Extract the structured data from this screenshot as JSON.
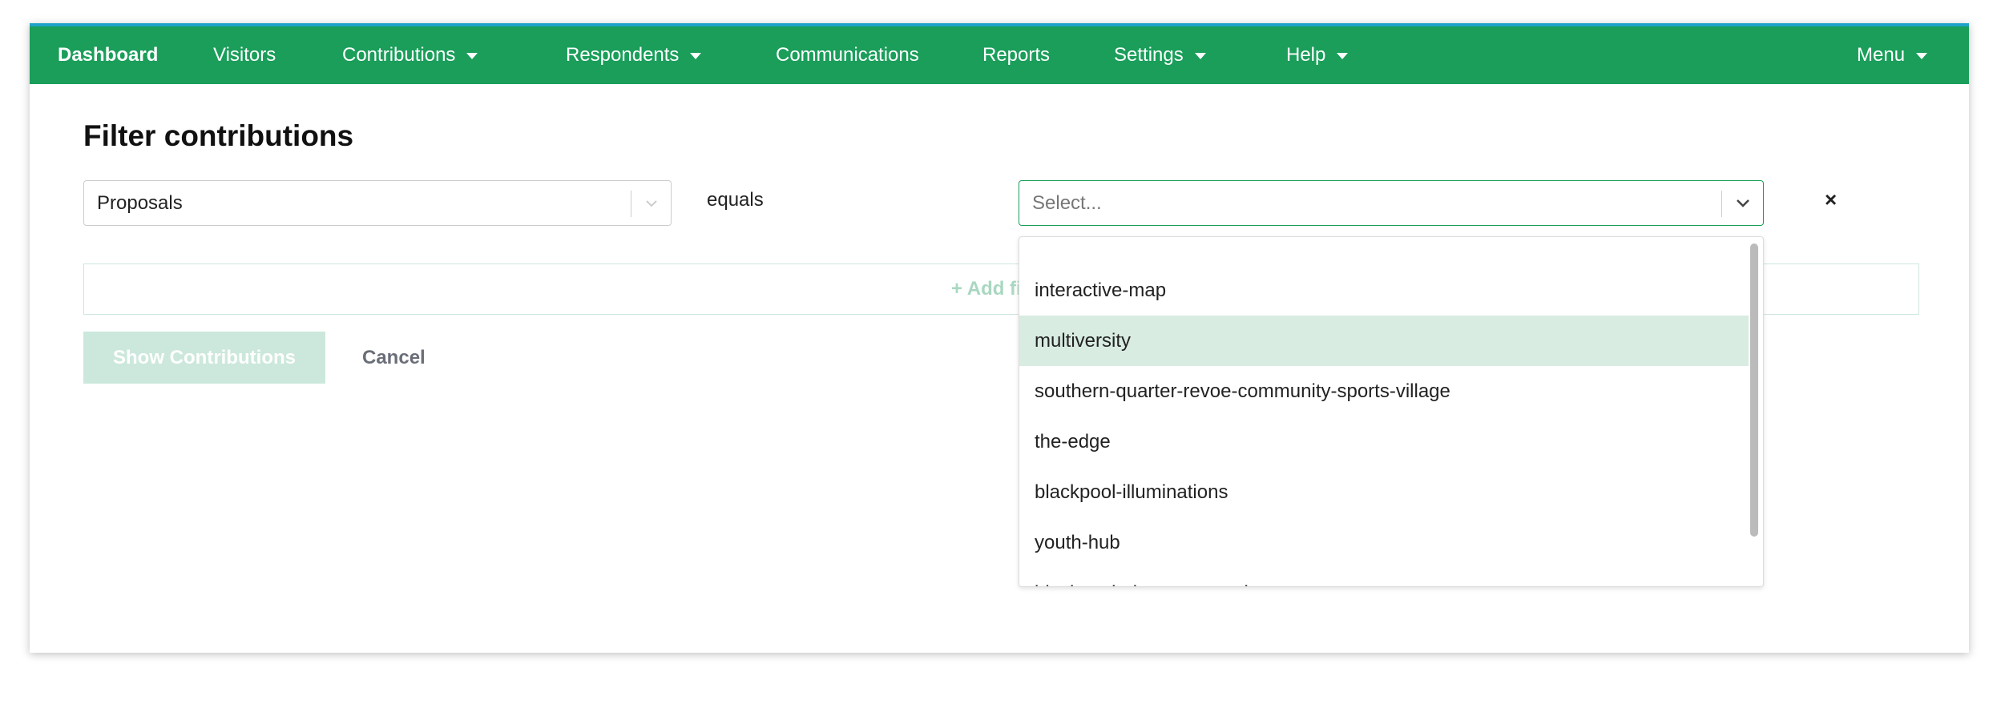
{
  "nav": {
    "items": [
      {
        "label": "Dashboard",
        "dropdown": false,
        "active": true
      },
      {
        "label": "Visitors",
        "dropdown": false
      },
      {
        "label": "Contributions",
        "dropdown": true
      },
      {
        "label": "Respondents",
        "dropdown": true
      },
      {
        "label": "Communications",
        "dropdown": false
      },
      {
        "label": "Reports",
        "dropdown": false
      },
      {
        "label": "Settings",
        "dropdown": true
      },
      {
        "label": "Help",
        "dropdown": true
      },
      {
        "label": "Menu",
        "dropdown": true
      }
    ],
    "color": "#1a9e5a"
  },
  "page": {
    "title": "Filter contributions"
  },
  "filter": {
    "field_value": "Proposals",
    "operator": "equals",
    "value_placeholder": "Select...",
    "remove_label": "×",
    "add_filter_label": "+ Add filter"
  },
  "dropdown": {
    "options": [
      "interactive-map",
      "multiversity",
      "southern-quarter-revoe-community-sports-village",
      "the-edge",
      "blackpool-illuminations",
      "youth-hub",
      "blackpool-airport-enterprise-zone"
    ],
    "highlighted": "multiversity"
  },
  "actions": {
    "show": "Show Contributions",
    "cancel": "Cancel"
  }
}
